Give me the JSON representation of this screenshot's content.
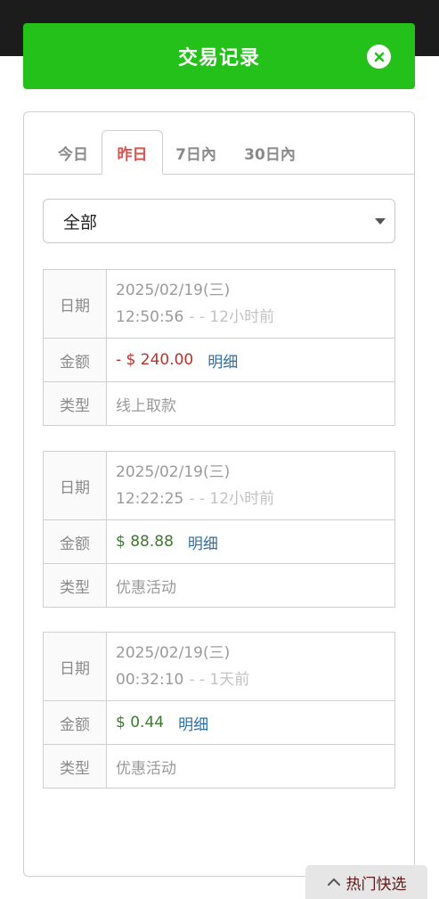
{
  "header": {
    "title": "交易记录"
  },
  "tabs": [
    {
      "label": "今日"
    },
    {
      "label": "昨日",
      "active": true
    },
    {
      "label": "7日內"
    },
    {
      "label": "30日內"
    }
  ],
  "filter": {
    "selected": "全部"
  },
  "labels": {
    "date": "日期",
    "amount": "金额",
    "type": "类型",
    "detail": "明细"
  },
  "records": [
    {
      "date": "2025/02/19(三)",
      "time": "12:50:56",
      "ago": "- - 12小时前",
      "amount": "- $ 240.00",
      "type": "线上取款"
    },
    {
      "date": "2025/02/19(三)",
      "time": "12:22:25",
      "ago": "- - 12小时前",
      "amount": "$ 88.88",
      "type": "优惠活动"
    },
    {
      "date": "2025/02/19(三)",
      "time": "00:32:10",
      "ago": "- - 1天前",
      "amount": "$ 0.44",
      "type": "优惠活动"
    }
  ],
  "quick_menu": {
    "label": "热门快选"
  },
  "colors": {
    "header_green": "#24c11b",
    "active_tab": "#d9534f",
    "negative": "#b8332b",
    "positive": "#3b7a2f",
    "link": "#2e6ea0"
  }
}
